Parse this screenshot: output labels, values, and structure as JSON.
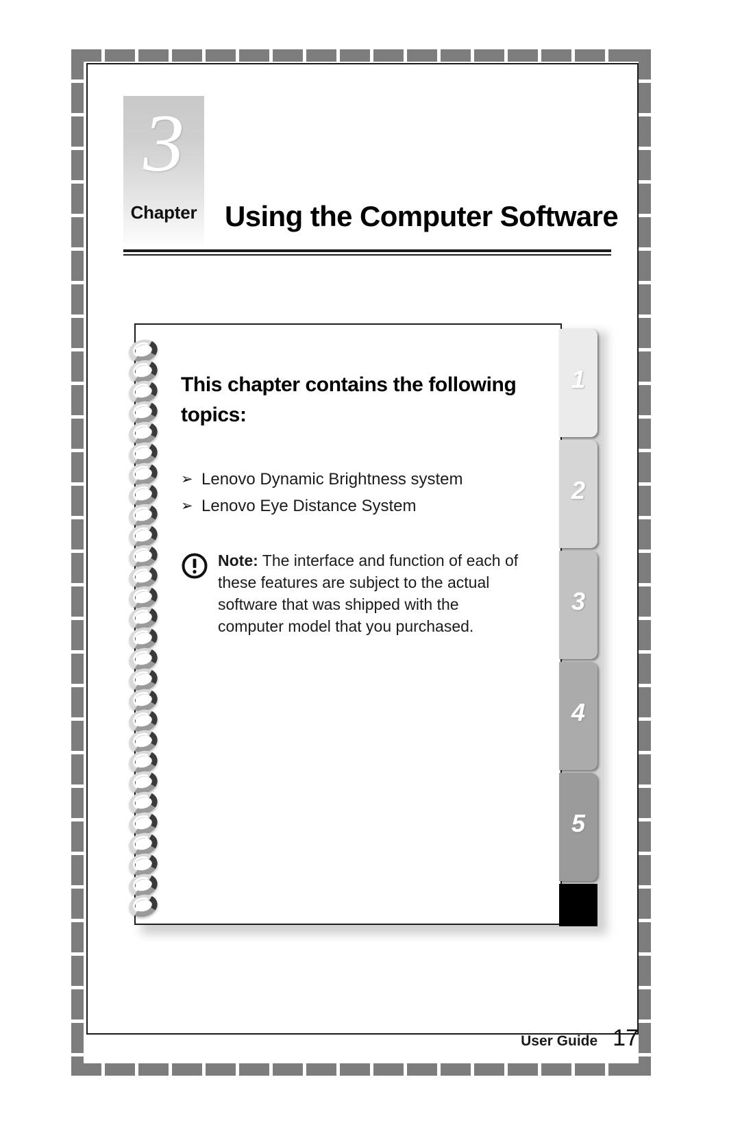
{
  "chapter": {
    "number": "3",
    "label": "Chapter",
    "title": "Using the Computer Software"
  },
  "notebook": {
    "heading": "This chapter contains the following topics:",
    "bullet_glyph": "➢",
    "topics": [
      "Lenovo Dynamic Brightness system",
      "Lenovo Eye Distance System"
    ],
    "note": {
      "icon": "exclamation-circle-icon",
      "label": "Note:",
      "body": "The interface and function of each of these features are subject to the actual software that was shipped with the computer model that you purchased."
    },
    "tabs": [
      {
        "number": "1",
        "color": "#ebebeb"
      },
      {
        "number": "2",
        "color": "#d6d6d6"
      },
      {
        "number": "3",
        "color": "#c2c2c2"
      },
      {
        "number": "4",
        "color": "#ababab"
      },
      {
        "number": "5",
        "color": "#9b9b9b"
      }
    ],
    "last_tab_color": "#000000"
  },
  "footer": {
    "label": "User Guide",
    "page_number": "17"
  },
  "colors": {
    "frame_dash": "#7d7d7d",
    "border": "#1a1a1a",
    "text": "#1b1b1b"
  }
}
